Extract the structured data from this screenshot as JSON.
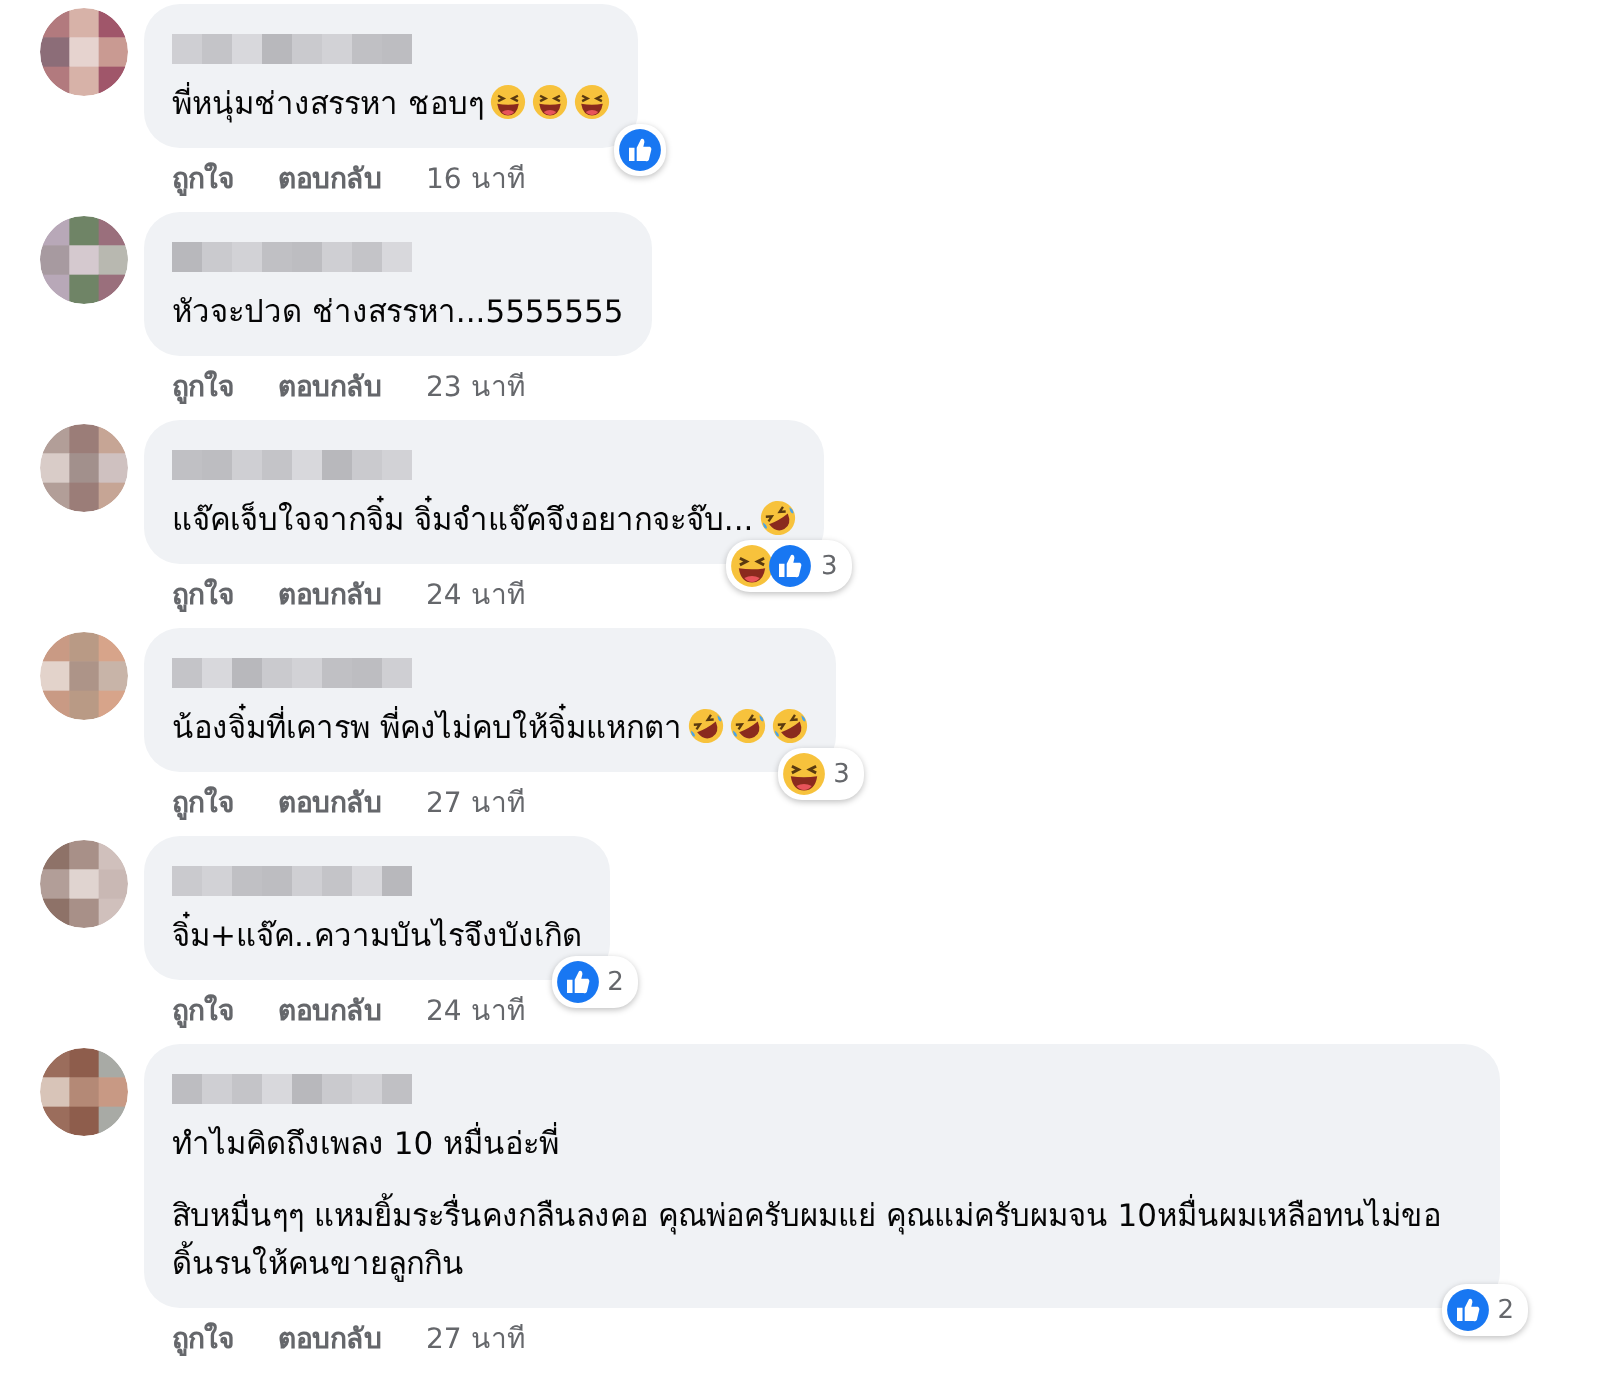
{
  "comments": [
    {
      "paragraphs": [
        "พี่หนุ่มช่างสรรหา ชอบๆ"
      ],
      "emojis": [
        {
          "kind": "laughing"
        },
        {
          "kind": "laughing"
        },
        {
          "kind": "laughing"
        }
      ],
      "reactions": [
        {
          "kind": "like"
        }
      ],
      "actions": [
        "ถูกใจ",
        "ตอบกลับ"
      ],
      "time": "16 นาที"
    },
    {
      "paragraphs": [
        "หัวจะปวด ช่างสรรหา...5555555"
      ],
      "actions": [
        "ถูกใจ",
        "ตอบกลับ"
      ],
      "time": "23 นาที"
    },
    {
      "paragraphs": [
        "แจ๊คเจ็บใจจากจิ๋ม จิ๋มจำแจ๊คจึงอยากจะจ๊บ..."
      ],
      "emojis": [
        {
          "kind": "rofl"
        }
      ],
      "reactions": [
        {
          "kind": "laughing"
        },
        {
          "kind": "like"
        }
      ],
      "reaction_count": "3",
      "actions": [
        "ถูกใจ",
        "ตอบกลับ"
      ],
      "time": "24 นาที"
    },
    {
      "paragraphs": [
        "น้องจิ๋มที่เคารพ พี่คงไม่คบให้จิ๋มแหกตา"
      ],
      "emojis": [
        {
          "kind": "rofl"
        },
        {
          "kind": "rofl"
        },
        {
          "kind": "rofl"
        }
      ],
      "reactions": [
        {
          "kind": "laughing"
        }
      ],
      "reaction_count": "3",
      "actions": [
        "ถูกใจ",
        "ตอบกลับ"
      ],
      "time": "27 นาที"
    },
    {
      "paragraphs": [
        "จิ๋ม+แจ๊ค..ความบันไรจึงบังเกิด"
      ],
      "reactions": [
        {
          "kind": "like"
        }
      ],
      "reaction_count": "2",
      "actions": [
        "ถูกใจ",
        "ตอบกลับ"
      ],
      "time": "24 นาที"
    },
    {
      "paragraphs": [
        "ทำไมคิดถึงเพลง 10 หมื่นอ่ะพี่",
        "สิบหมื่นๆๆ แหมยิ้มระรื่นคงกลืนลงคอ คุณพ่อครับผมแย่ คุณแม่ครับผมจน 10หมื่นผมเหลือทนไม่ขอดิ้นรนให้คนขายลูกกิน"
      ],
      "reactions": [
        {
          "kind": "like"
        }
      ],
      "reaction_count": "2",
      "actions": [
        "ถูกใจ",
        "ตอบกลับ"
      ],
      "time": "27 นาที"
    }
  ]
}
